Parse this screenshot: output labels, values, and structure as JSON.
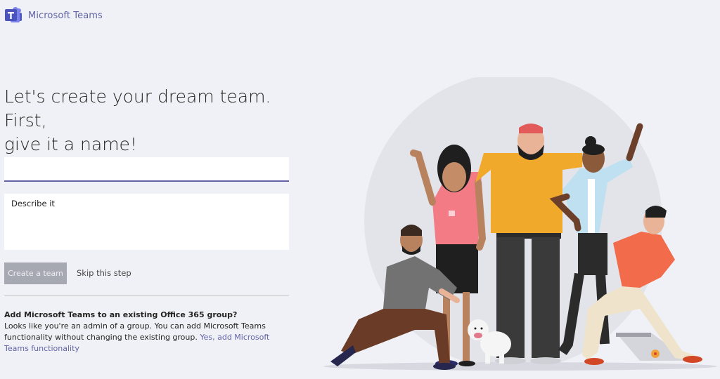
{
  "header": {
    "app_name": "Microsoft Teams",
    "logo_icon": "teams-logo-icon"
  },
  "main": {
    "headline_line1": "Let's create your dream team. First,",
    "headline_line2": "give it a name!",
    "team_name": {
      "value": "",
      "placeholder": ""
    },
    "description": {
      "placeholder": "Describe it"
    },
    "create_button": "Create a team",
    "skip_link": "Skip this step",
    "group": {
      "title": "Add Microsoft Teams to an existing Office 365 group?",
      "text": "Looks like you're an admin of a group. You can add Microsoft Teams functionality without changing the existing group. ",
      "link": "Yes, add Microsoft Teams functionality"
    }
  },
  "colors": {
    "accent": "#6264a7",
    "background": "#f0f1f6",
    "disabled_button": "#a7a9b2"
  }
}
